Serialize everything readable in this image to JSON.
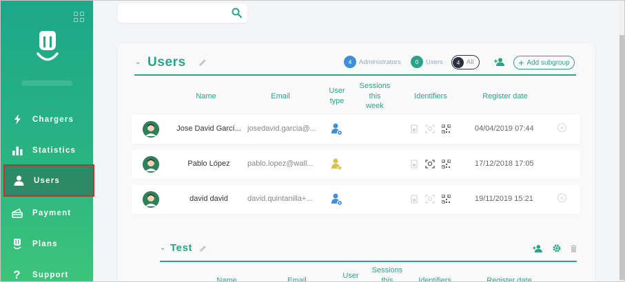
{
  "sidebar": {
    "items": [
      {
        "label": "Chargers",
        "icon": "bolt-icon"
      },
      {
        "label": "Statistics",
        "icon": "bar-chart-icon"
      },
      {
        "label": "Users",
        "icon": "user-icon",
        "active": true
      },
      {
        "label": "Payment",
        "icon": "payment-card-icon"
      },
      {
        "label": "Plans",
        "icon": "plug-icon"
      },
      {
        "label": "Support",
        "icon": "question-icon"
      }
    ]
  },
  "search": {
    "placeholder": "",
    "value": ""
  },
  "group": {
    "title": "Users",
    "filters": {
      "administrators": {
        "count": "4",
        "label": "Administrators"
      },
      "users": {
        "count": "0",
        "label": "Users"
      },
      "all": {
        "count": "4",
        "label": "All"
      }
    },
    "add_subgroup_label": "Add subgroup",
    "columns": [
      "Name",
      "Email",
      "User type",
      "Sessions this week",
      "Identifiers",
      "Register date"
    ],
    "column_lines": {
      "user_type": [
        "User",
        "type"
      ],
      "sessions": [
        "Sessions",
        "this",
        "week"
      ]
    },
    "rows": [
      {
        "name": "Jose David Garcí...",
        "email": "josedavid.garcia@...",
        "user_type": "admin",
        "date": "04/04/2019 07:44",
        "removable": true
      },
      {
        "name": "Pablo López",
        "email": "pablo.lopez@wall...",
        "user_type": "owner",
        "date": "17/12/2018 17:05",
        "removable": false
      },
      {
        "name": "david david",
        "email": "david.quintanilla+...",
        "user_type": "admin",
        "date": "19/11/2019 15:21",
        "removable": true
      }
    ]
  },
  "subgroup": {
    "title": "Test",
    "columns": [
      "Name",
      "Email",
      "User",
      "Sessions",
      "this",
      "Identifiers",
      "Register date"
    ]
  },
  "colors": {
    "accent": "#2aa389",
    "admin_blue": "#3f8fd8",
    "owner_gold": "#d8c04a",
    "dark": "#2b2f3e"
  }
}
